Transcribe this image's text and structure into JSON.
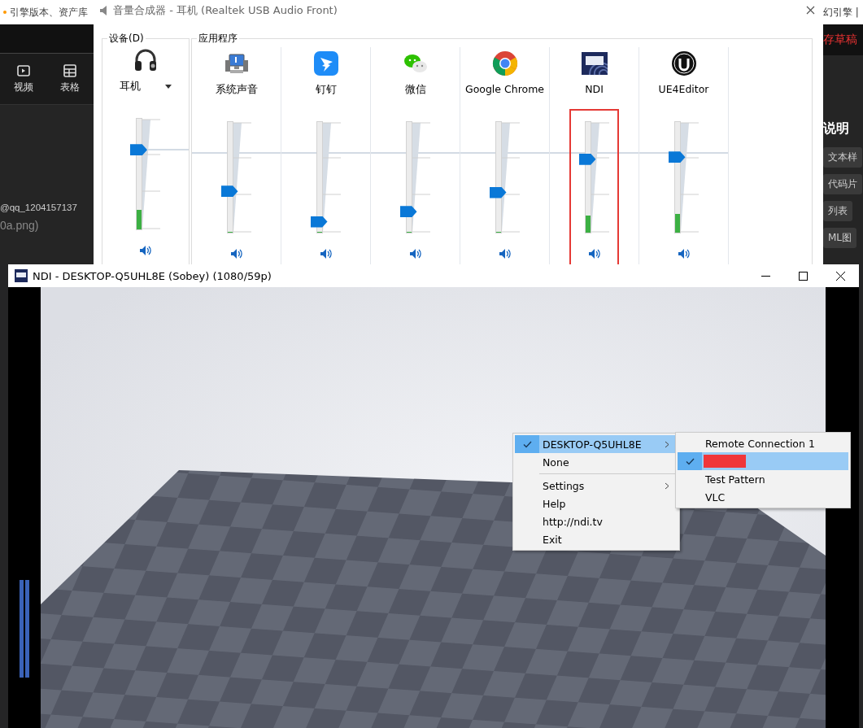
{
  "background_app": {
    "top_left_text": "引擎版本、资产库",
    "toolbar": [
      {
        "label": "视频",
        "kind": "video"
      },
      {
        "label": "表格",
        "kind": "table"
      }
    ],
    "left_texts": [
      "@qq_1204157137",
      "0a.png)"
    ],
    "top_right_text": "幻引擎 |",
    "save_draft": "存草稿",
    "panel_title": "说明",
    "tags": [
      "文本样",
      "代码片",
      "列表",
      "ML图"
    ]
  },
  "mixer": {
    "title": "音量合成器 - 耳机 (Realtek USB Audio Front)",
    "device_group": "设备(D)",
    "apps_group": "应用程序",
    "device": {
      "name": "耳机",
      "level": 0.74,
      "meter": {
        "level": 0.17
      }
    },
    "apps": [
      {
        "name": "系统声音",
        "kind": "speakers",
        "level": 0.36,
        "meter": {
          "level": 0
        },
        "highlighted": false
      },
      {
        "name": "钉钉",
        "kind": "dingtalk",
        "level": 0.06,
        "meter": {
          "level": 0
        },
        "highlighted": false
      },
      {
        "name": "微信",
        "kind": "wechat",
        "level": 0.16,
        "meter": {
          "level": 0
        },
        "highlighted": false
      },
      {
        "name": "Google Chrome",
        "kind": "chrome",
        "level": 0.35,
        "meter": {
          "level": 0
        },
        "highlighted": false
      },
      {
        "name": "NDI",
        "kind": "ndi",
        "level": 0.68,
        "meter": {
          "level": 0.15
        },
        "highlighted": true
      },
      {
        "name": "UE4Editor",
        "kind": "unreal",
        "level": 0.7,
        "meter": {
          "level": 0.16
        },
        "highlighted": false
      }
    ]
  },
  "ndi_window": {
    "title": "NDI - DESKTOP-Q5UHL8E (Sobey) (1080/59p)",
    "menu": [
      {
        "kind": "item",
        "label": "DESKTOP-Q5UHL8E",
        "checked": true,
        "selected": true,
        "submenu": true
      },
      {
        "kind": "item",
        "label": "None",
        "checked": false,
        "selected": false,
        "submenu": false
      },
      {
        "kind": "separator"
      },
      {
        "kind": "item",
        "label": "Settings",
        "checked": false,
        "selected": false,
        "submenu": true
      },
      {
        "kind": "item",
        "label": "Help",
        "checked": false,
        "selected": false,
        "submenu": false
      },
      {
        "kind": "item",
        "label": "http://ndi.tv",
        "checked": false,
        "selected": false,
        "submenu": false
      },
      {
        "kind": "item",
        "label": "Exit",
        "checked": false,
        "selected": false,
        "submenu": false
      }
    ],
    "submenu": [
      {
        "kind": "item",
        "label": "Remote Connection 1",
        "checked": false,
        "selected": false
      },
      {
        "kind": "redacted",
        "checked": true,
        "selected": true
      },
      {
        "kind": "item",
        "label": "Test Pattern",
        "checked": false,
        "selected": false
      },
      {
        "kind": "item",
        "label": "VLC",
        "checked": false,
        "selected": false
      }
    ]
  }
}
